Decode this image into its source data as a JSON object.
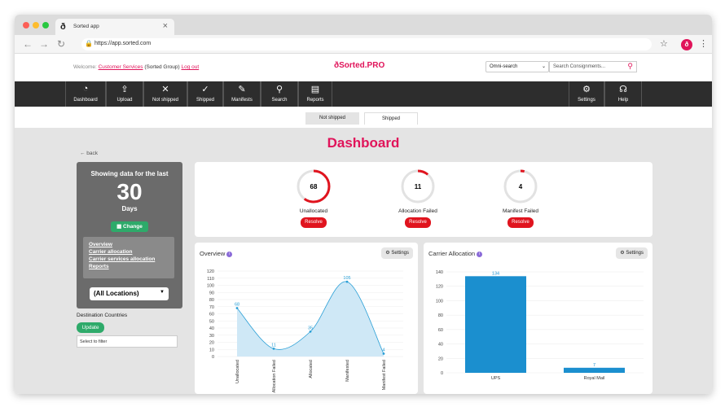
{
  "browser": {
    "tab_title": "Sorted app",
    "tab_close": "×",
    "url": "https://app.sorted.com",
    "tab_logo": "sorted-logo-icon"
  },
  "header": {
    "welcome_prefix": "Welcome:",
    "user": "Customer Services",
    "group": "(Sorted Group)",
    "logout": "Log out",
    "logo": "Sorted.PRO",
    "omni_search": "Omni-search",
    "search_placeholder": "Search Consignments..."
  },
  "nav": {
    "items": [
      {
        "label": "Dashboard",
        "icon": "dashboard-icon"
      },
      {
        "label": "Upload",
        "icon": "upload-icon"
      },
      {
        "label": "Not shipped",
        "icon": "x-icon"
      },
      {
        "label": "Shipped",
        "icon": "check-icon"
      },
      {
        "label": "Manifests",
        "icon": "manifest-icon"
      },
      {
        "label": "Search",
        "icon": "search-icon"
      },
      {
        "label": "Reports",
        "icon": "reports-icon"
      },
      {
        "label": "Settings",
        "icon": "gear-icon"
      },
      {
        "label": "Help",
        "icon": "headset-icon"
      }
    ]
  },
  "subtabs": {
    "not_shipped": "Not shipped",
    "shipped": "Shipped"
  },
  "page": {
    "title": "Dashboard",
    "back": "← back"
  },
  "sidebar": {
    "heading": "Showing data for the last",
    "count": "30",
    "unit": "Days",
    "change": "Change",
    "links": [
      "Overview",
      "Carrier allocation",
      "Carrier services allocation",
      "Reports"
    ],
    "location": "(All Locations)",
    "dest_label": "Destination Countries",
    "update": "Update",
    "filter_placeholder": "Select to filter"
  },
  "stats": [
    {
      "value": "68",
      "label": "Unallocated",
      "button": "Resolve",
      "fraction": 0.6
    },
    {
      "value": "11",
      "label": "Allocation Failed",
      "button": "Resolve",
      "fraction": 0.11
    },
    {
      "value": "4",
      "label": "Manifest Failed",
      "button": "Resolve",
      "fraction": 0.04
    }
  ],
  "overview": {
    "title": "Overview",
    "settings": "Settings"
  },
  "carrier": {
    "title": "Carrier Allocation",
    "settings": "Settings"
  },
  "chart_data": [
    {
      "type": "area",
      "title": "Overview",
      "categories": [
        "Unallocated",
        "Allocation Failed",
        "Allocated",
        "Manifested",
        "Manifest Failed"
      ],
      "values": [
        68,
        11,
        35,
        105,
        4
      ],
      "ylim": [
        0,
        120
      ],
      "yticks": [
        0,
        10,
        20,
        30,
        40,
        50,
        60,
        70,
        80,
        90,
        100,
        110,
        120
      ],
      "color": "#2a9fd6"
    },
    {
      "type": "bar",
      "title": "Carrier Allocation",
      "categories": [
        "UPS",
        "Royal Mail"
      ],
      "values": [
        134,
        7
      ],
      "ylim": [
        0,
        140
      ],
      "yticks": [
        0,
        20,
        40,
        60,
        80,
        100,
        120,
        140
      ],
      "color": "#1b8fcf"
    }
  ]
}
